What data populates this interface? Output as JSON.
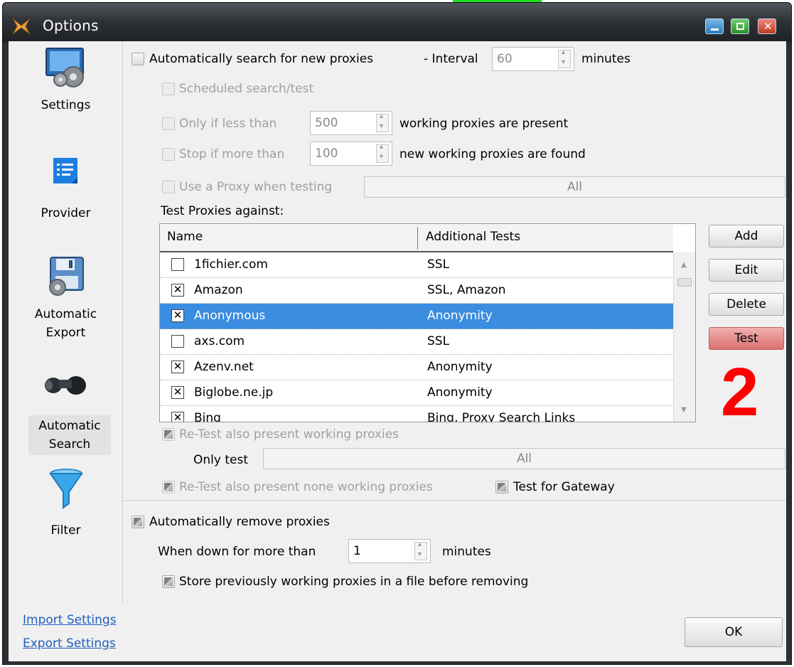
{
  "window": {
    "title": "Options"
  },
  "sidebar": {
    "items": [
      {
        "label": "Settings"
      },
      {
        "label": "Provider"
      },
      {
        "label_line1": "Automatic",
        "label_line2": "Export"
      },
      {
        "label_line1": "Automatic",
        "label_line2": "Search",
        "selected": true
      },
      {
        "label": "Filter"
      }
    ],
    "links": {
      "import": "Import Settings",
      "export": "Export Settings"
    }
  },
  "search": {
    "auto_search_label": "Automatically search for new proxies",
    "interval_label": "- Interval",
    "interval_value": "60",
    "interval_unit": "minutes",
    "scheduled_label": "Scheduled search/test",
    "only_if_label": "Only if less than",
    "only_if_value": "500",
    "only_if_suffix": "working proxies are present",
    "stop_if_label": "Stop if more than",
    "stop_if_value": "100",
    "stop_if_suffix": "new working proxies are found",
    "use_proxy_label": "Use a Proxy when testing",
    "use_proxy_combo": "All"
  },
  "test_grid": {
    "heading": "Test Proxies against:",
    "columns": [
      "Name",
      "Additional Tests"
    ],
    "rows": [
      {
        "checked": false,
        "name": "1fichier.com",
        "tests": "SSL"
      },
      {
        "checked": true,
        "name": "Amazon",
        "tests": "SSL, Amazon"
      },
      {
        "checked": true,
        "name": "Anonymous",
        "tests": "Anonymity",
        "selected": true
      },
      {
        "checked": false,
        "name": "axs.com",
        "tests": "SSL"
      },
      {
        "checked": true,
        "name": "Azenv.net",
        "tests": "Anonymity"
      },
      {
        "checked": true,
        "name": "Biglobe.ne.jp",
        "tests": "Anonymity"
      },
      {
        "checked": true,
        "name": "Bing",
        "tests": "Bing, Proxy Search Links"
      }
    ],
    "buttons": {
      "add": "Add",
      "edit": "Edit",
      "delete": "Delete",
      "test": "Test"
    }
  },
  "annotation": {
    "number": "2",
    "color": "#ff0000"
  },
  "retest": {
    "present_working_label": "Re-Test also present working proxies",
    "only_test_label": "Only test",
    "only_test_combo": "All",
    "none_working_label": "Re-Test also present none working proxies",
    "gateway_label": "Test for Gateway"
  },
  "remove": {
    "auto_remove_label": "Automatically remove proxies",
    "down_label": "When down for more than",
    "down_value": "1",
    "down_unit": "minutes",
    "store_label": "Store previously working proxies in a file before removing"
  },
  "footer": {
    "ok_label": "OK"
  }
}
